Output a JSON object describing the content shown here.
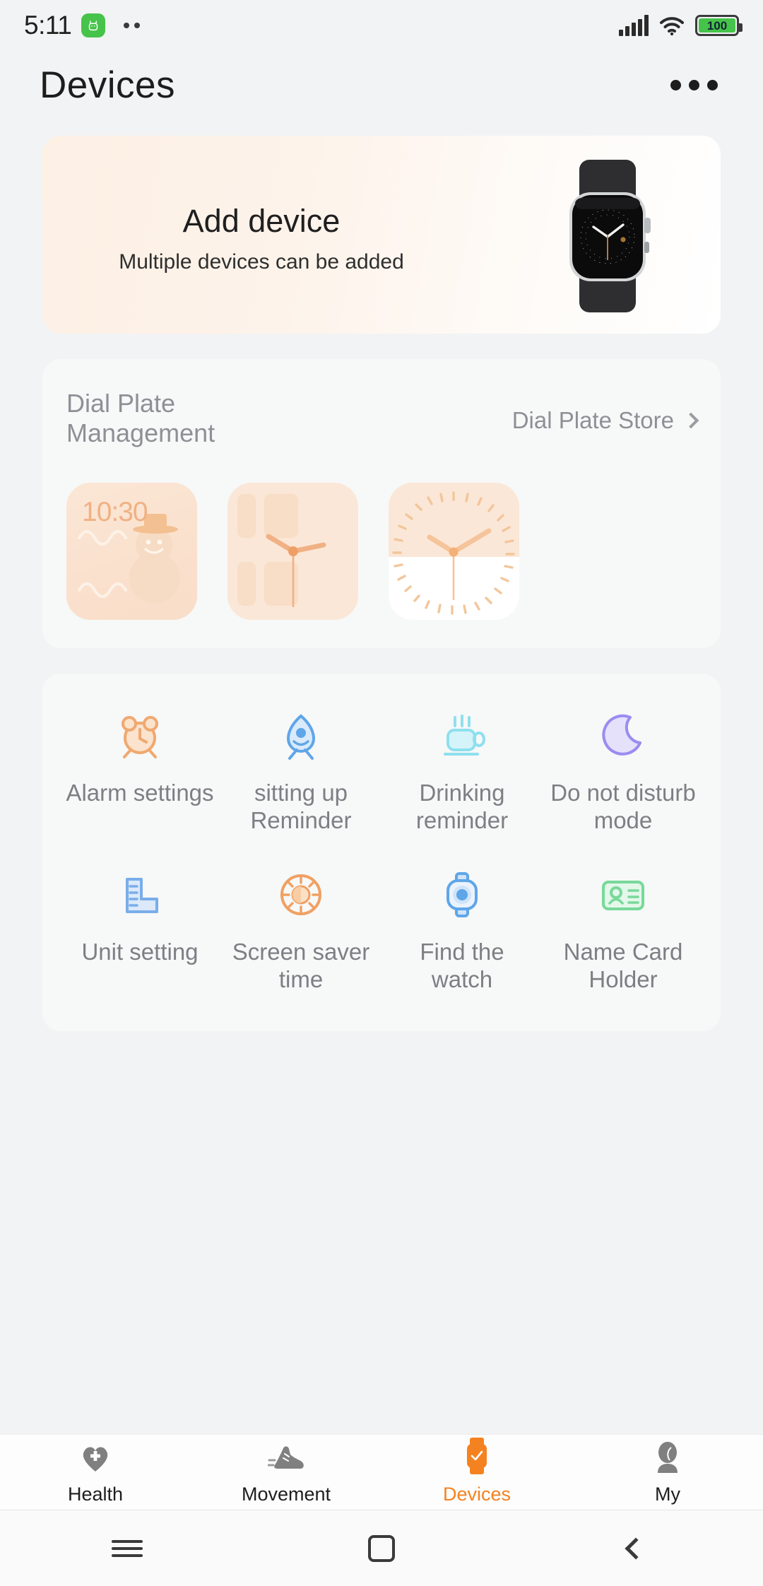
{
  "statusbar": {
    "time": "5:11",
    "app_icon": "android-robot-icon",
    "notification_dots": 2,
    "signal_icon": "cellular-signal-icon",
    "wifi_icon": "wifi-icon",
    "battery_level": "100"
  },
  "header": {
    "title": "Devices",
    "more_icon": "more-options-icon"
  },
  "add_device": {
    "title": "Add device",
    "subtitle": "Multiple devices can be added",
    "image": "smartwatch-photo"
  },
  "dial_plate": {
    "title": "Dial Plate Management",
    "store_label": "Dial Plate Store",
    "chevron_icon": "chevron-right-icon",
    "thumbs": [
      {
        "name": "snowman-watch-face",
        "time": "10:30"
      },
      {
        "name": "digits-analog-watch-face",
        "time": ""
      },
      {
        "name": "ticks-analog-watch-face",
        "time": ""
      }
    ]
  },
  "features": [
    {
      "label": "Alarm settings",
      "icon": "alarm-clock-icon",
      "color": "#f0a970"
    },
    {
      "label": "sitting up Reminder",
      "icon": "sitting-up-icon",
      "color": "#5fa6e8"
    },
    {
      "label": "Drinking reminder",
      "icon": "teacup-icon",
      "color": "#8ee0ee"
    },
    {
      "label": "Do not disturb mode",
      "icon": "crescent-moon-icon",
      "color": "#9a8cf0"
    },
    {
      "label": "Unit setting",
      "icon": "ruler-icon",
      "color": "#7aadea"
    },
    {
      "label": "Screen saver time",
      "icon": "brightness-sun-icon",
      "color": "#f0a062"
    },
    {
      "label": "Find the watch",
      "icon": "watch-locate-icon",
      "color": "#5fa6e8"
    },
    {
      "label": "Name Card Holder",
      "icon": "id-card-icon",
      "color": "#78d99a"
    }
  ],
  "bottom_nav": {
    "active_color": "#f58220",
    "items": [
      {
        "label": "Health",
        "icon": "heart-plus-icon",
        "active": false
      },
      {
        "label": "Movement",
        "icon": "running-shoe-icon",
        "active": false
      },
      {
        "label": "Devices",
        "icon": "watch-check-icon",
        "active": true
      },
      {
        "label": "My",
        "icon": "person-icon",
        "active": false
      }
    ]
  },
  "system_nav": {
    "menu_icon": "menu-icon",
    "home_icon": "home-square-icon",
    "back_icon": "back-chevron-icon"
  }
}
